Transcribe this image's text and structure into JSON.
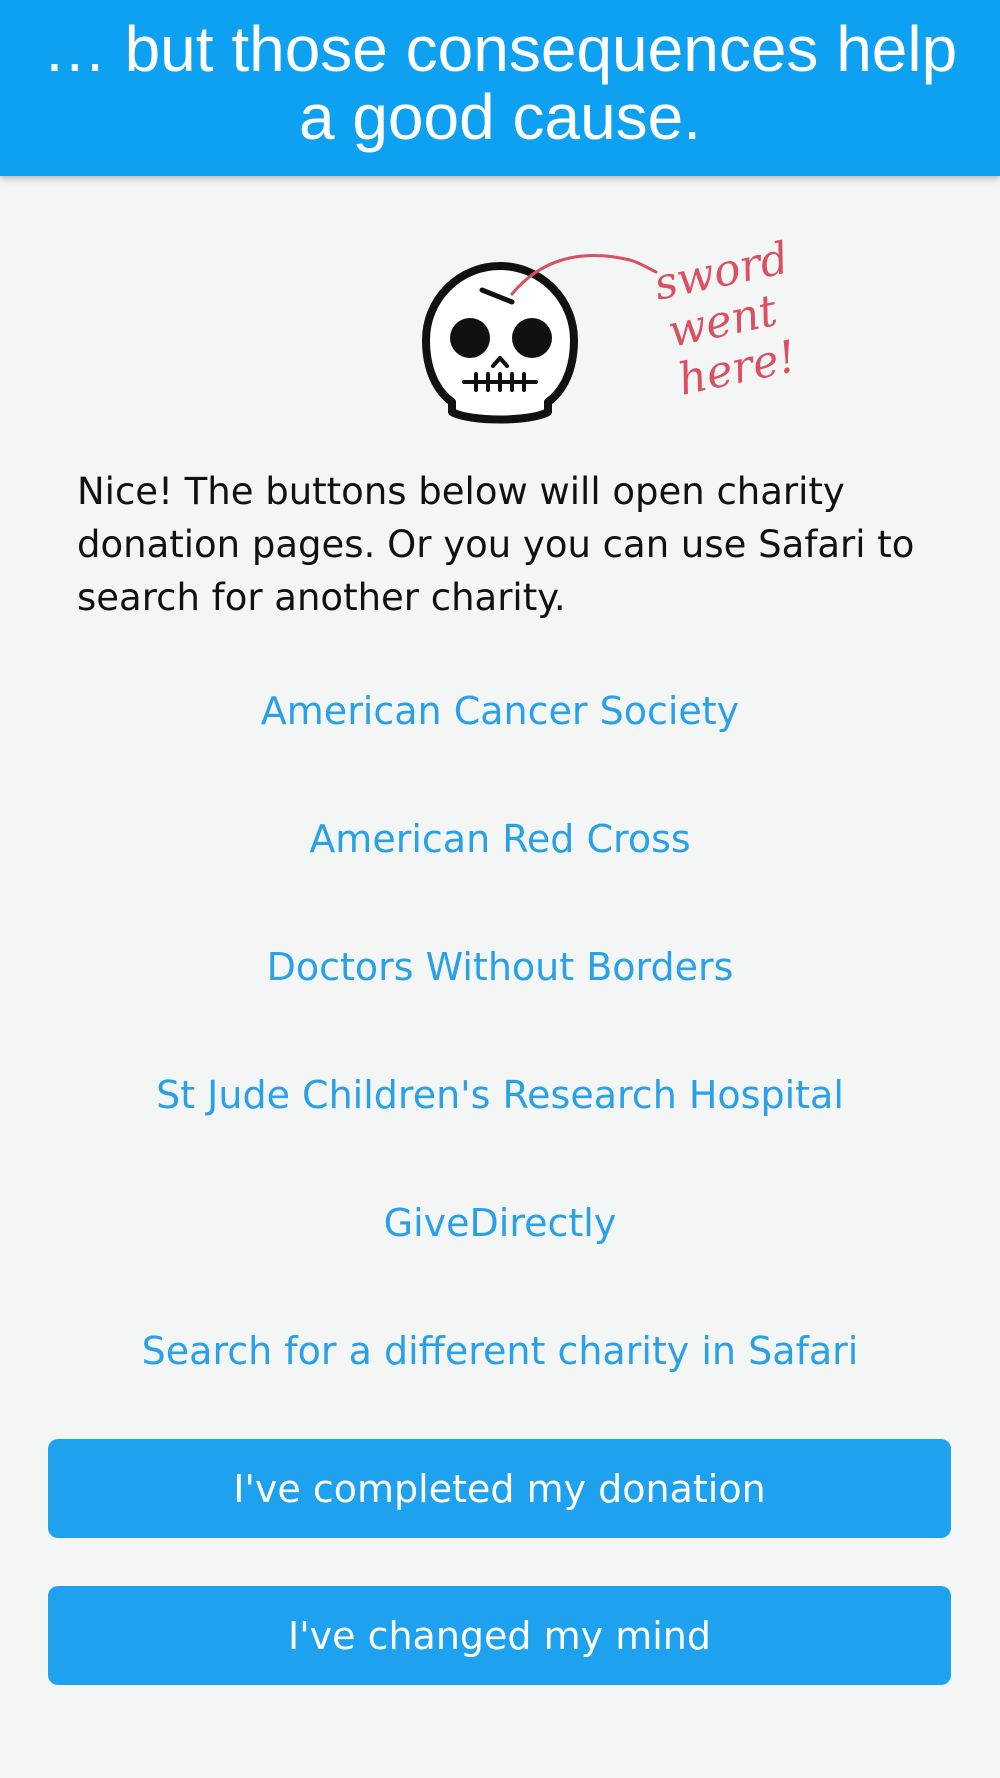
{
  "header": {
    "title": "… but those consequences help a good cause."
  },
  "illustration": {
    "icon": "skull-icon",
    "annotation_text": "sword went here!",
    "annotation_color": "#d95062"
  },
  "message": "Nice!  The buttons below will open charity donation pages.  Or you you can use Safari to search for another charity.",
  "charities": [
    {
      "label": "American Cancer Society"
    },
    {
      "label": "American Red Cross"
    },
    {
      "label": "Doctors Without Borders"
    },
    {
      "label": "St Jude Children's Research Hospital"
    },
    {
      "label": "GiveDirectly"
    },
    {
      "label": "Search for a different charity in Safari"
    }
  ],
  "actions": {
    "completed_label": "I've completed my donation",
    "changed_mind_label": "I've changed my mind"
  },
  "colors": {
    "header_bg": "#0fa1f1",
    "link": "#29a0e8",
    "button_bg": "#1ea2ef",
    "page_bg": "#f4f5f5"
  }
}
